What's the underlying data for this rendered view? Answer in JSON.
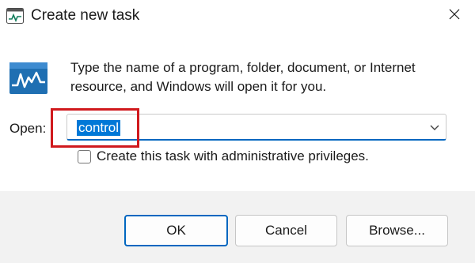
{
  "window": {
    "title": "Create new task",
    "app_icon": "task-manager-icon",
    "close_icon": "close-icon"
  },
  "main": {
    "icon": "run-icon",
    "description": "Type the name of a program, folder, document, or Internet resource, and Windows will open it for you.",
    "open_label": "Open:",
    "open_value": "control",
    "dropdown_icon": "chevron-down-icon",
    "admin_checkbox_label": "Create this task with administrative privileges.",
    "admin_checkbox_checked": false
  },
  "buttons": {
    "ok": "OK",
    "cancel": "Cancel",
    "browse": "Browse..."
  },
  "colors": {
    "accent": "#0067c0",
    "selection": "#0078d7",
    "highlight_box": "#d0191d",
    "footer_bg": "#f2f2f2"
  }
}
